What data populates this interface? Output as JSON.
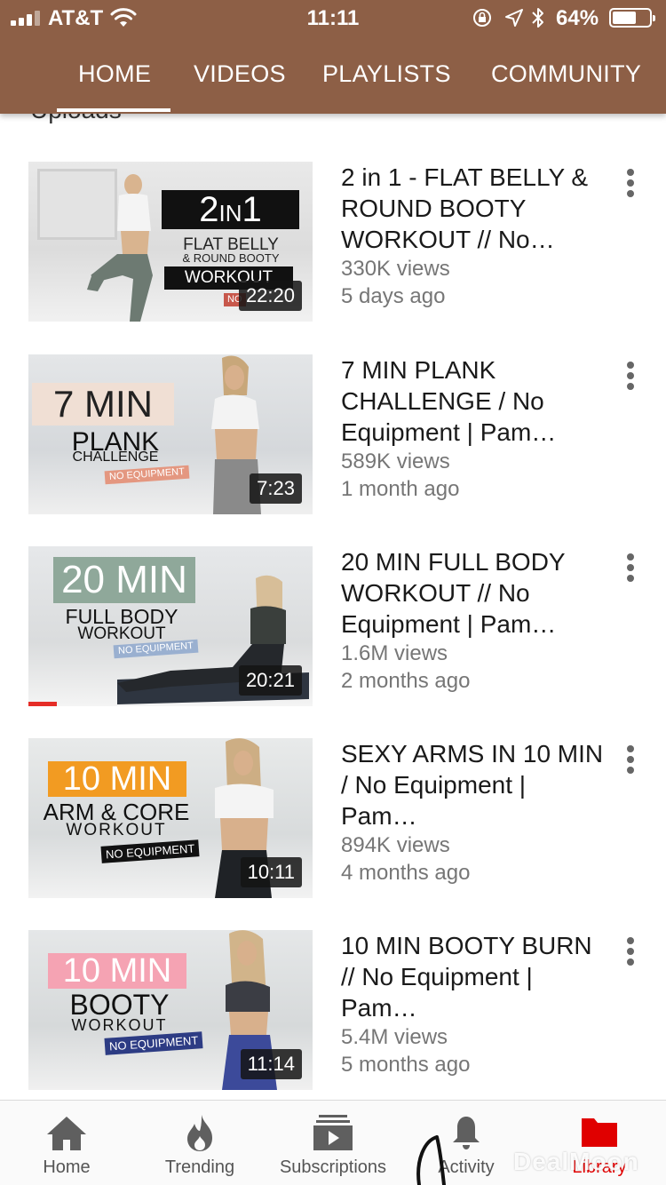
{
  "status_bar": {
    "carrier": "AT&T",
    "time": "11:11",
    "battery_percent": "64%",
    "battery_level": 0.64
  },
  "channel_tabs": {
    "items": [
      {
        "label": "HOME",
        "selected": true
      },
      {
        "label": "VIDEOS",
        "selected": false
      },
      {
        "label": "PLAYLISTS",
        "selected": false
      },
      {
        "label": "COMMUNITY",
        "selected": false
      }
    ]
  },
  "section_peek": "Uploads",
  "videos": [
    {
      "thumb_text": [
        "2",
        "IN",
        "1",
        "FLAT BELLY",
        "& ROUND BOOTY",
        "WORKOUT",
        "NO"
      ],
      "duration": "22:20",
      "title": "2 in 1 - FLAT BELLY & ROUND BOOTY WORKOUT  // No…",
      "views": "330K views",
      "age": "5 days ago",
      "watched_fraction": 0
    },
    {
      "thumb_text": [
        "7 MIN",
        "PLANK",
        "CHALLENGE",
        "NO EQUIPMENT"
      ],
      "duration": "7:23",
      "title": "7 MIN PLANK CHALLENGE / No Equipment | Pam…",
      "views": "589K views",
      "age": "1 month ago",
      "watched_fraction": 0
    },
    {
      "thumb_text": [
        "20 MIN",
        "FULL BODY",
        "WORKOUT",
        "NO EQUIPMENT"
      ],
      "duration": "20:21",
      "title": "20 MIN FULL BODY WORKOUT // No Equipment | Pam…",
      "views": "1.6M views",
      "age": "2 months ago",
      "watched_fraction": 0.1
    },
    {
      "thumb_text": [
        "10 MIN",
        "ARM & CORE",
        "WORKOUT",
        "NO EQUIPMENT"
      ],
      "duration": "10:11",
      "title": "SEXY ARMS IN 10 MIN  / No Equipment | Pam…",
      "views": "894K views",
      "age": "4 months ago",
      "watched_fraction": 0
    },
    {
      "thumb_text": [
        "10 MIN",
        "BOOTY",
        "WORKOUT",
        "NO EQUIPMENT"
      ],
      "duration": "11:14",
      "title": "10 MIN BOOTY BURN // No Equipment | Pam…",
      "views": "5.4M views",
      "age": "5 months ago",
      "watched_fraction": 0
    }
  ],
  "bottom_nav": {
    "items": [
      {
        "label": "Home",
        "icon": "home-icon",
        "active": false
      },
      {
        "label": "Trending",
        "icon": "flame-icon",
        "active": false
      },
      {
        "label": "Subscriptions",
        "icon": "subscriptions-icon",
        "active": false
      },
      {
        "label": "Activity",
        "icon": "bell-icon",
        "active": false
      },
      {
        "label": "Library",
        "icon": "folder-icon",
        "active": true
      }
    ]
  },
  "watermark": "DealMoon",
  "colors": {
    "header_bg": "#8d5f46",
    "active_red": "#e00000",
    "progress_red": "#e52d27"
  }
}
